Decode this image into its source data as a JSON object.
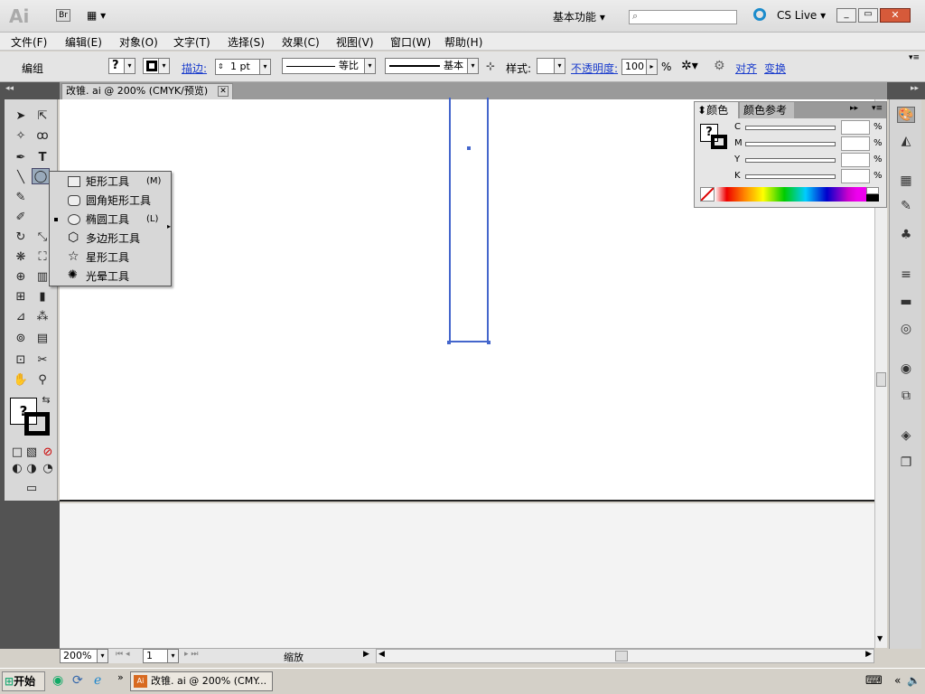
{
  "app": {
    "logo": "Ai",
    "bridge": "Br",
    "workspace": "基本功能",
    "cslive": "CS Live"
  },
  "menu": [
    "文件(F)",
    "编辑(E)",
    "对象(O)",
    "文字(T)",
    "选择(S)",
    "效果(C)",
    "视图(V)",
    "窗口(W)",
    "帮助(H)"
  ],
  "control": {
    "group_label": "编组",
    "fill": "?",
    "stroke_link": "描边:",
    "stroke_weight": "1 pt",
    "stroke_profile": "等比",
    "brush": "基本",
    "style_label": "样式:",
    "opacity_link": "不透明度:",
    "opacity_value": "100",
    "pct": "%",
    "align_link": "对齐",
    "transform_link": "变换"
  },
  "doc_tab": {
    "title": "改锥. ai @ 200% (CMYK/预览)"
  },
  "flyout": {
    "items": [
      {
        "label": "矩形工具",
        "shortcut": "(M)",
        "icon": "rectangle-icon"
      },
      {
        "label": "圆角矩形工具",
        "shortcut": "",
        "icon": "rounded-rectangle-icon"
      },
      {
        "label": "椭圆工具",
        "shortcut": "(L)",
        "icon": "ellipse-icon",
        "selected": true
      },
      {
        "label": "多边形工具",
        "shortcut": "",
        "icon": "polygon-icon"
      },
      {
        "label": "星形工具",
        "shortcut": "",
        "icon": "star-icon"
      },
      {
        "label": "光晕工具",
        "shortcut": "",
        "icon": "flare-icon"
      }
    ]
  },
  "color_panel": {
    "tab1": "颜色",
    "tab2": "颜色参考",
    "channels": [
      "C",
      "M",
      "Y",
      "K"
    ],
    "pct": "%",
    "swatch": "?"
  },
  "status": {
    "zoom": "200%",
    "page": "1",
    "label": "缩放"
  },
  "taskbar": {
    "start": "开始",
    "window": "改锥. ai @ 200% (CMY..."
  },
  "colors": {
    "accent": "#1a3ccc",
    "selection": "#4466cc"
  }
}
